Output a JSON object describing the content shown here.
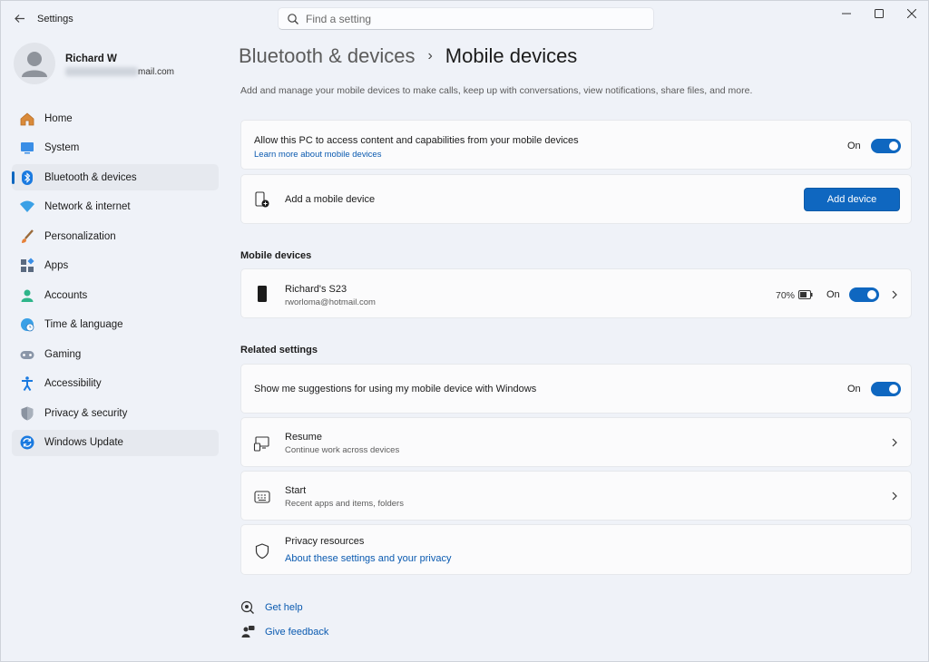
{
  "app": {
    "title": "Settings",
    "search_placeholder": "Find a setting"
  },
  "profile": {
    "name": "Richard W",
    "email_suffix": "mail.com"
  },
  "sidebar": {
    "items": [
      {
        "label": "Home",
        "icon": "home-icon"
      },
      {
        "label": "System",
        "icon": "system-icon"
      },
      {
        "label": "Bluetooth & devices",
        "icon": "bluetooth-icon",
        "active": true
      },
      {
        "label": "Network & internet",
        "icon": "wifi-icon"
      },
      {
        "label": "Personalization",
        "icon": "brush-icon"
      },
      {
        "label": "Apps",
        "icon": "apps-icon"
      },
      {
        "label": "Accounts",
        "icon": "accounts-icon"
      },
      {
        "label": "Time & language",
        "icon": "globe-icon"
      },
      {
        "label": "Gaming",
        "icon": "gamepad-icon"
      },
      {
        "label": "Accessibility",
        "icon": "accessibility-icon"
      },
      {
        "label": "Privacy & security",
        "icon": "shield-icon"
      },
      {
        "label": "Windows Update",
        "icon": "update-icon"
      }
    ]
  },
  "header": {
    "parent": "Bluetooth & devices",
    "separator": "›",
    "current": "Mobile devices",
    "description": "Add and manage your mobile devices to make calls, keep up with conversations, view notifications, share files, and more."
  },
  "allow_access": {
    "title": "Allow this PC to access content and capabilities from your mobile devices",
    "link": "Learn more about mobile devices",
    "toggle_label": "On",
    "toggle_on": true
  },
  "add_device": {
    "title": "Add a mobile device",
    "button": "Add device"
  },
  "mobile_devices": {
    "section_title": "Mobile devices",
    "devices": [
      {
        "name": "Richard's S23",
        "account": "rworloma@hotmail.com",
        "battery": "70%",
        "toggle_label": "On",
        "toggle_on": true
      }
    ]
  },
  "related": {
    "section_title": "Related settings",
    "suggestions": {
      "title": "Show me suggestions for using my mobile device with Windows",
      "toggle_label": "On",
      "toggle_on": true
    },
    "resume": {
      "title": "Resume",
      "subtitle": "Continue work across devices"
    },
    "start": {
      "title": "Start",
      "subtitle": "Recent apps and items, folders"
    },
    "privacy": {
      "title": "Privacy resources",
      "link": "About these settings and your privacy"
    }
  },
  "help": {
    "get_help": "Get help",
    "give_feedback": "Give feedback"
  },
  "colors": {
    "accent": "#0f67c0",
    "background": "#f0f3f9",
    "card": "#fbfbfc",
    "link": "#0a5ab0"
  }
}
